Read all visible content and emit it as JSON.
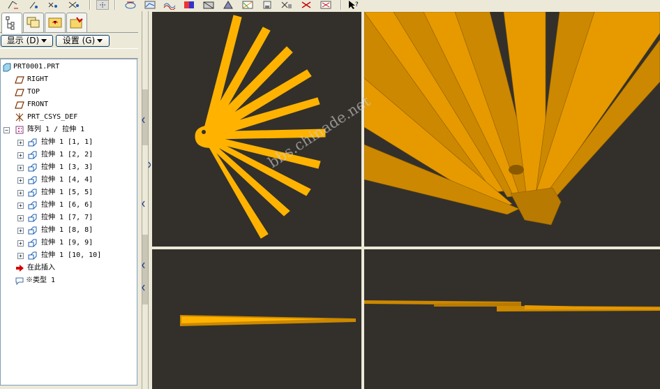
{
  "toolbar": {
    "icons": [
      "sketch-datum-icon",
      "datum-axis-icon",
      "datum-point-icon",
      "datum-point-offset-icon",
      "datum-point-field-icon",
      "coord-sys-icon",
      "sketch-icon",
      "view-compare-icon",
      "blend-icon",
      "wave-icon",
      "color-icon",
      "model-icon",
      "shaded-icon",
      "section-icon",
      "render-icon",
      "analysis-icon",
      "check-icon",
      "error-check-icon",
      "measure-error-icon",
      "context-help-icon"
    ]
  },
  "nav_tabs": [
    "model-tree-tab",
    "layer-tab",
    "folder-browser-tab",
    "favorites-tab"
  ],
  "buttons": {
    "display": "显示 (D)",
    "settings": "设置 (G)"
  },
  "tree": {
    "root": "PRT0001.PRT",
    "datums": [
      "RIGHT",
      "TOP",
      "FRONT"
    ],
    "csys": "PRT_CSYS_DEF",
    "pattern": "阵列 1 / 拉伸 1",
    "members": [
      "拉伸 1 [1, 1]",
      "拉伸 1 [2, 2]",
      "拉伸 1 [3, 3]",
      "拉伸 1 [4, 4]",
      "拉伸 1 [5, 5]",
      "拉伸 1 [6, 6]",
      "拉伸 1 [7, 7]",
      "拉伸 1 [8, 8]",
      "拉伸 1 [9, 9]",
      "拉伸 1 [10, 10]"
    ],
    "insert_here": "在此插入",
    "type_item": "※类型 1"
  },
  "colors": {
    "viewport_bg": "#33302b",
    "model_fill": "#ffb300",
    "model_shaded": "#cc8800",
    "model_edge": "#8a5a00"
  },
  "watermark": "bbs.chinade.net"
}
